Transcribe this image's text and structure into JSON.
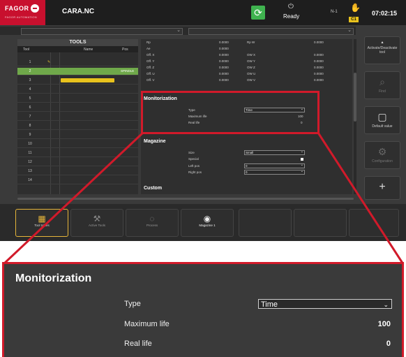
{
  "header": {
    "brand": "FAGOR",
    "brand_sub": "FAGOR AUTOMATION",
    "program": "CARA.NC",
    "status": "Ready",
    "channel": "N-1",
    "channel_badge": "C1",
    "time": "07:02:15"
  },
  "tools": {
    "title": "TOOLS",
    "columns": [
      "Tool",
      "Name",
      "Pos"
    ],
    "rows": [
      {
        "n": "1",
        "pos": ""
      },
      {
        "n": "2",
        "pos": "SPINDLE"
      },
      {
        "n": "3",
        "pos": ""
      },
      {
        "n": "4",
        "pos": ""
      },
      {
        "n": "5",
        "pos": ""
      },
      {
        "n": "6",
        "pos": ""
      },
      {
        "n": "7",
        "pos": ""
      },
      {
        "n": "8",
        "pos": ""
      },
      {
        "n": "9",
        "pos": ""
      },
      {
        "n": "10",
        "pos": ""
      },
      {
        "n": "11",
        "pos": ""
      },
      {
        "n": "12",
        "pos": ""
      },
      {
        "n": "13",
        "pos": ""
      },
      {
        "n": "14",
        "pos": ""
      }
    ]
  },
  "detail": {
    "offsets": [
      {
        "l": "Rp",
        "v": "0.0000",
        "l2": "Rp W",
        "v2": "0.0000"
      },
      {
        "l": "Ae",
        "v": "0.0000",
        "l2": "",
        "v2": ""
      },
      {
        "l": "Off. X",
        "v": "0.0000",
        "l2": "OW X",
        "v2": "0.0000"
      },
      {
        "l": "Off. Y",
        "v": "0.0000",
        "l2": "OW Y",
        "v2": "0.0000"
      },
      {
        "l": "Off. Z",
        "v": "0.0000",
        "l2": "OW Z",
        "v2": "0.0000"
      },
      {
        "l": "Off. U",
        "v": "0.0000",
        "l2": "OW U",
        "v2": "0.0000"
      },
      {
        "l": "Off. V",
        "v": "0.0000",
        "l2": "OW V",
        "v2": "0.0000"
      }
    ],
    "monitorization": {
      "heading": "Monitorization",
      "type_label": "Type",
      "type_value": "Time",
      "max_life_label": "Maximum life",
      "max_life_value": "100",
      "real_life_label": "Real life",
      "real_life_value": "0"
    },
    "magazine": {
      "heading": "Magazine",
      "size_label": "Size",
      "size_value": "Small",
      "special_label": "Special",
      "left_pos_label": "Left pos",
      "left_pos_value": "0",
      "right_pos_label": "Right pos",
      "right_pos_value": "0"
    },
    "custom_heading": "Custom"
  },
  "right_buttons": [
    {
      "icon": "toggle-icon",
      "label": "Activate/Deactivate tool"
    },
    {
      "icon": "search-icon",
      "label": "Find"
    },
    {
      "icon": "default-value-icon",
      "label": "Default value"
    },
    {
      "icon": "gear-icon",
      "label": "Configuration"
    },
    {
      "icon": "plus-icon",
      "label": ""
    }
  ],
  "bottom_tabs": [
    {
      "label": "Tool tables",
      "icon": "table-icon"
    },
    {
      "label": "Active Tools",
      "icon": "tools-icon"
    },
    {
      "label": "Process",
      "icon": "process-icon"
    },
    {
      "label": "Magazine 1",
      "icon": "magazine-icon"
    }
  ],
  "colors": {
    "brand_red": "#c8102e",
    "callout_red": "#d11a2a",
    "selected_row": "#6fa84a",
    "active_tab": "#e6b53a",
    "cycle_green": "#3fb34f"
  }
}
